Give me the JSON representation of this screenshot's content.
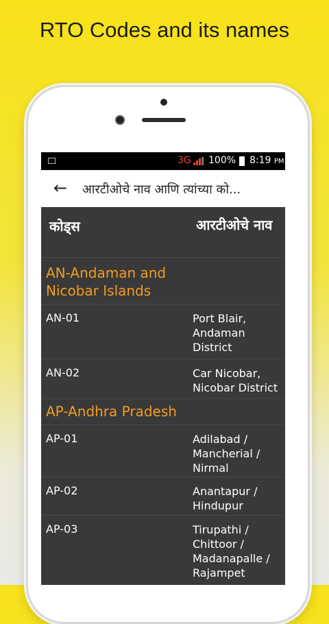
{
  "headline": "RTO Codes and its names",
  "status_bar": {
    "network": "3G",
    "battery": "100%",
    "time": "8:19",
    "ampm": "PM"
  },
  "app_bar": {
    "title": "आरटीओचे नाव आणि त्यांच्या को..."
  },
  "columns": {
    "code_header": "कोड्स",
    "name_header": "आरटीओचे नाव"
  },
  "sections": [
    {
      "title_line1": "AN-Andaman and",
      "title_line2": "Nicobar Islands",
      "rows": [
        {
          "code": "AN-01",
          "name_lines": [
            "Port Blair,",
            "Andaman",
            "District"
          ]
        },
        {
          "code": "AN-02",
          "name_lines": [
            "Car Nicobar,",
            "Nicobar District"
          ]
        }
      ]
    },
    {
      "title_line1": "AP-Andhra Pradesh",
      "rows": [
        {
          "code": "AP-01",
          "name_lines": [
            "Adilabad /",
            "Mancherial /",
            "Nirmal"
          ]
        },
        {
          "code": "AP-02",
          "name_lines": [
            "Anantapur /",
            "Hindupur"
          ]
        },
        {
          "code": "AP-03",
          "name_lines": [
            "Tirupathi /",
            "Chittoor /",
            "Madanapalle /",
            "Rajampet"
          ]
        }
      ]
    }
  ],
  "colors": {
    "accent": "#f39c22",
    "background_yellow": "#f7e21a",
    "list_background": "#393939"
  }
}
